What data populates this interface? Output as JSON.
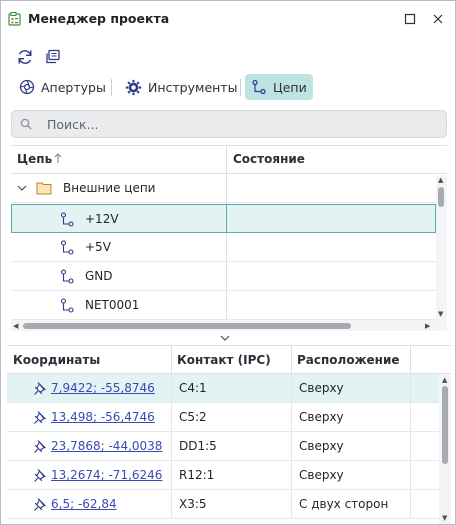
{
  "window": {
    "title": "Менеджер проекта"
  },
  "toolbar": {
    "refresh_icon": "refresh-icon",
    "copy_icon": "copy-icon"
  },
  "tabs": [
    {
      "label": "Апертуры",
      "icon": "aperture-icon",
      "active": false
    },
    {
      "label": "Инструменты",
      "icon": "gear-icon",
      "active": false
    },
    {
      "label": "Цепи",
      "icon": "net-icon",
      "active": true
    }
  ],
  "search": {
    "placeholder": "Поиск..."
  },
  "nets_table": {
    "columns": [
      "Цепь",
      "Состояние"
    ],
    "sort_indicator": "↑",
    "group": {
      "label": "Внешние цепи",
      "expanded": true
    },
    "rows": [
      {
        "label": "+12V",
        "selected": true
      },
      {
        "label": "+5V",
        "selected": false
      },
      {
        "label": "GND",
        "selected": false
      },
      {
        "label": "NET0001",
        "selected": false
      }
    ]
  },
  "contacts_table": {
    "columns": [
      "Координаты",
      "Контакт (IPC)",
      "Расположение"
    ],
    "rows": [
      {
        "coord": "7,9422; -55,8746",
        "contact": "C4:1",
        "place": "Сверху",
        "selected": true
      },
      {
        "coord": "13,498; -56,4746",
        "contact": "C5:2",
        "place": "Сверху",
        "selected": false
      },
      {
        "coord": "23,7868; -44,0038",
        "contact": "DD1:5",
        "place": "Сверху",
        "selected": false
      },
      {
        "coord": "13,2674; -71,6246",
        "contact": "R12:1",
        "place": "Сверху",
        "selected": false
      },
      {
        "coord": "6,5; -62,84",
        "contact": "X3:5",
        "place": "С двух сторон",
        "selected": false
      }
    ]
  },
  "colors": {
    "accent": "#bfe3e3",
    "selection": "#e1f3f3",
    "link": "#3a49b6"
  }
}
